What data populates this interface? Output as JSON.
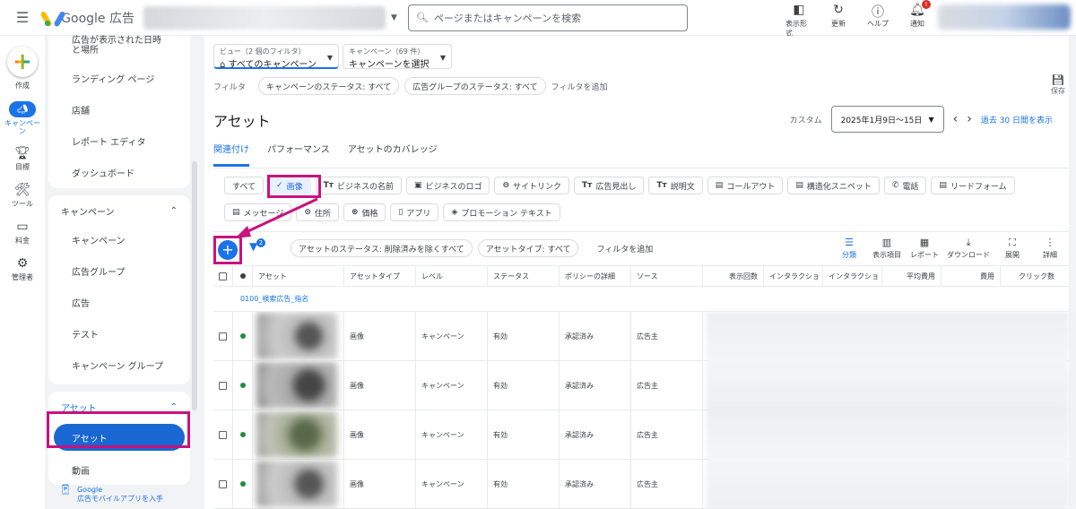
{
  "topbar": {
    "product": "Google 広告",
    "search_placeholder": "ページまたはキャンペーンを検索",
    "actions": [
      {
        "label": "表示形式",
        "icon": "appearance-icon"
      },
      {
        "label": "更新",
        "icon": "refresh-icon"
      },
      {
        "label": "ヘルプ",
        "icon": "help-icon"
      },
      {
        "label": "通知",
        "icon": "bell-icon",
        "badge": "!"
      }
    ]
  },
  "rail": {
    "create": "作成",
    "campaigns": "キャンペーン",
    "goals": "目標",
    "tools": "ツール",
    "billing": "料金",
    "admin": "管理者"
  },
  "nav": {
    "top_items": [
      "広告が表示された日時と場所",
      "ランディング ページ",
      "店舗",
      "レポート エディタ",
      "ダッシュボード"
    ],
    "campaigns_header": "キャンペーン",
    "campaign_items": [
      "キャンペーン",
      "広告グループ",
      "広告",
      "テスト",
      "キャンペーン グループ"
    ],
    "assets_header": "アセット",
    "assets_active": "アセット",
    "assets_items": [
      "動画"
    ],
    "mobile_line1": "Google",
    "mobile_line2": "広告モバイルアプリを入手"
  },
  "view": {
    "view_label": "ビュー（2 個のフィルタ）",
    "view_value": "すべてのキャンペーン",
    "campaign_label": "キャンペーン（69 件）",
    "campaign_value": "キャンペーンを選択"
  },
  "filters": {
    "label": "フィルタ",
    "chips": [
      "キャンペーンのステータス: すべて",
      "広告グループのステータス: すべて"
    ],
    "add": "フィルタを追加",
    "save": "保存"
  },
  "page": {
    "title": "アセット",
    "custom": "カスタム",
    "date": "2025年1月9日～15日",
    "compare": "過去 30 日間を表示"
  },
  "tabs": [
    "関連付け",
    "パフォーマンス",
    "アセットのカバレッジ"
  ],
  "asset_types": [
    {
      "label": "すべて",
      "icon": ""
    },
    {
      "label": "画像",
      "icon": "✓"
    },
    {
      "label": "ビジネスの名前",
      "icon": "Tт"
    },
    {
      "label": "ビジネスのロゴ",
      "icon": "▣"
    },
    {
      "label": "サイトリンク",
      "icon": "⊖"
    },
    {
      "label": "広告見出し",
      "icon": "Tт"
    },
    {
      "label": "説明文",
      "icon": "Tт"
    },
    {
      "label": "コールアウト",
      "icon": "▤"
    },
    {
      "label": "構造化スニペット",
      "icon": "▤"
    },
    {
      "label": "電話",
      "icon": "✆"
    },
    {
      "label": "リードフォーム",
      "icon": "▤"
    },
    {
      "label": "メッセージ",
      "icon": "▤"
    },
    {
      "label": "住所",
      "icon": "⊙"
    },
    {
      "label": "価格",
      "icon": "⊛"
    },
    {
      "label": "アプリ",
      "icon": "▯"
    },
    {
      "label": "プロモーション テキスト",
      "icon": "◈"
    }
  ],
  "table_filters": {
    "badge": "2",
    "chips": [
      "アセットのステータス: 削除済みを除くすべて",
      "アセットタイプ: すべて"
    ],
    "add": "フィルタを追加"
  },
  "tools": [
    {
      "label": "分類",
      "icon": "☰"
    },
    {
      "label": "表示項目",
      "icon": "▥"
    },
    {
      "label": "レポート",
      "icon": "▦"
    },
    {
      "label": "ダウンロード",
      "icon": "⤓"
    },
    {
      "label": "展開",
      "icon": "⛶"
    },
    {
      "label": "詳細",
      "icon": "⋮"
    }
  ],
  "columns": [
    "アセット",
    "アセットタイプ",
    "レベル",
    "ステータス",
    "ポリシーの詳細",
    "ソース",
    "表示回数",
    "インタラクショ",
    "インタラクショ",
    "平均費用",
    "費用",
    "クリック数"
  ],
  "group_label": "0100_検索広告_指名",
  "rows": [
    {
      "type": "画像",
      "level": "キャンペーン",
      "status": "有効",
      "policy": "承認済み",
      "source": "広告主"
    },
    {
      "type": "画像",
      "level": "キャンペーン",
      "status": "有効",
      "policy": "承認済み",
      "source": "広告主"
    },
    {
      "type": "画像",
      "level": "キャンペーン",
      "status": "有効",
      "policy": "承認済み",
      "source": "広告主"
    },
    {
      "type": "画像",
      "level": "キャンペーン",
      "status": "有効",
      "policy": "承認済み",
      "source": "広告主"
    }
  ],
  "colors": {
    "accent": "#1a73e8",
    "highlight": "#c8127e",
    "active_nav": "#1967d2"
  }
}
